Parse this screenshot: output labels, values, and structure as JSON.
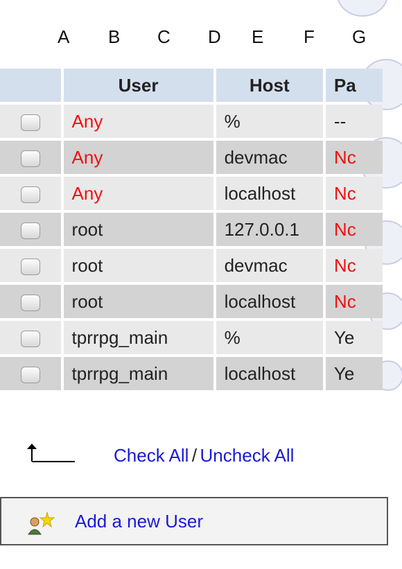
{
  "columns_letters": [
    "A",
    "B",
    "C",
    "D",
    "E",
    "F",
    "G"
  ],
  "table": {
    "headers": [
      "",
      "User",
      "Host",
      "Pa"
    ],
    "rows": [
      {
        "user": "Any",
        "host": "%",
        "password": "--",
        "user_color": "#ee1111",
        "pass_color": "#222222"
      },
      {
        "user": "Any",
        "host": "devmac",
        "password": "Nc",
        "user_color": "#ee1111",
        "pass_color": "#ee1111"
      },
      {
        "user": "Any",
        "host": "localhost",
        "password": "Nc",
        "user_color": "#ee1111",
        "pass_color": "#ee1111"
      },
      {
        "user": "root",
        "host": "127.0.0.1",
        "password": "Nc",
        "user_color": "#222222",
        "pass_color": "#ee1111"
      },
      {
        "user": "root",
        "host": "devmac",
        "password": "Nc",
        "user_color": "#222222",
        "pass_color": "#ee1111"
      },
      {
        "user": "root",
        "host": "localhost",
        "password": "Nc",
        "user_color": "#222222",
        "pass_color": "#ee1111"
      },
      {
        "user": "tprrpg_main",
        "host": "%",
        "password": "Ye",
        "user_color": "#222222",
        "pass_color": "#222222"
      },
      {
        "user": "tprrpg_main",
        "host": "localhost",
        "password": "Ye",
        "user_color": "#222222",
        "pass_color": "#222222"
      }
    ]
  },
  "check_all": "Check All",
  "separator": "/",
  "uncheck_all": "Uncheck All",
  "add_user": "Add a new User",
  "colors": {
    "header_bg": "#d4dfee",
    "link": "#1a1ad4",
    "warning": "#ee1111"
  }
}
